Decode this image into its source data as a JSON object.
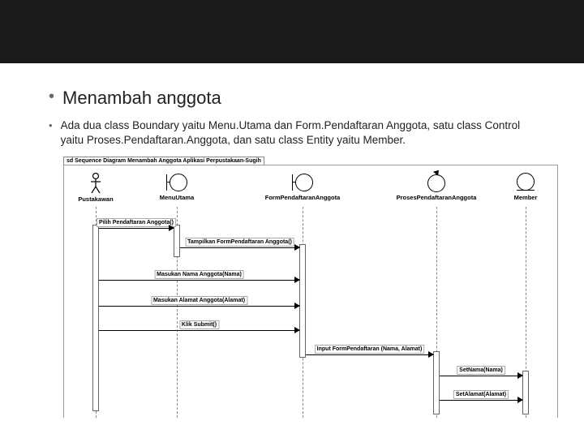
{
  "slide": {
    "title": "Menambah anggota",
    "desc": "Ada dua class Boundary yaitu Menu.Utama dan Form.Pendaftaran Anggota, satu class Control yaitu Proses.Pendaftaran.Anggota, dan satu class Entity yaitu Member."
  },
  "diagram": {
    "frame_title": "sd Sequence Diagram Menambah Anggota Aplikasi Perpustakaan-Sugih",
    "participants": {
      "actor": "Pustakawan",
      "boundary1": "MenuUtama",
      "boundary2": "FormPendaftaranAnggota",
      "control": "ProsesPendaftaranAnggota",
      "entity": "Member"
    },
    "messages": {
      "m1": "Pilih Pendaftaran Anggota()",
      "m2": "Tampilkan FormPendaftaran Anggota()",
      "m3": "Masukan Nama Anggota(Nama)",
      "m4": "Masukan Alamat Anggota(Alamat)",
      "m5": "Klik Submit()",
      "m6": "Input FormPendaftaran (Nama, Alamat)",
      "m7": "SetNama(Nama)",
      "m8": "SetAlamat(Alamat)"
    }
  }
}
